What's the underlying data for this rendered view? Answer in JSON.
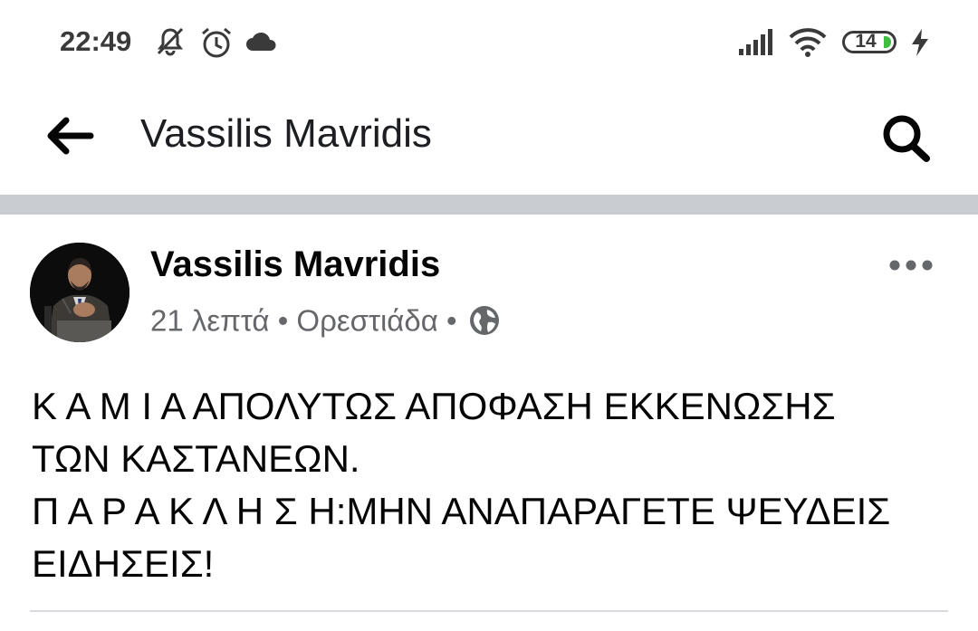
{
  "status_bar": {
    "time": "22:49",
    "left_icons": [
      "bell-muted-icon",
      "alarm-icon",
      "cloud-icon"
    ],
    "right_icons": [
      "signal-icon",
      "wifi-icon",
      "battery-icon",
      "charging-icon"
    ],
    "battery_level": "14",
    "battery_fill_color": "#3fbf3f"
  },
  "top_bar": {
    "title": "Vassilis Mavridis",
    "back_icon": "back-arrow-icon",
    "search_icon": "search-icon"
  },
  "post": {
    "author": "Vassilis Mavridis",
    "time_ago": "21 λεπτά",
    "separator": "•",
    "location": "Ορεστιάδα",
    "privacy_icon": "globe-icon",
    "more_icon": "more-options-icon",
    "text_lines": [
      "Κ Α Μ Ι Α ΑΠΟΛΥΤΩΣ ΑΠΟΦΑΣΗ ΕΚΚΕΝΩΣΗΣ",
      "ΤΩΝ ΚΑΣΤΑΝΕΩΝ.",
      "Π Α Ρ Α Κ Λ Η Σ Η:ΜΗΝ ΑΝΑΠΑΡΑΓΕΤΕ ΨΕΥΔΕΙΣ",
      "ΕΙΔΗΣΕΙΣ!"
    ]
  },
  "colors": {
    "divider": "#c9ccd1",
    "meta_text": "#65676b",
    "text": "#050505"
  }
}
